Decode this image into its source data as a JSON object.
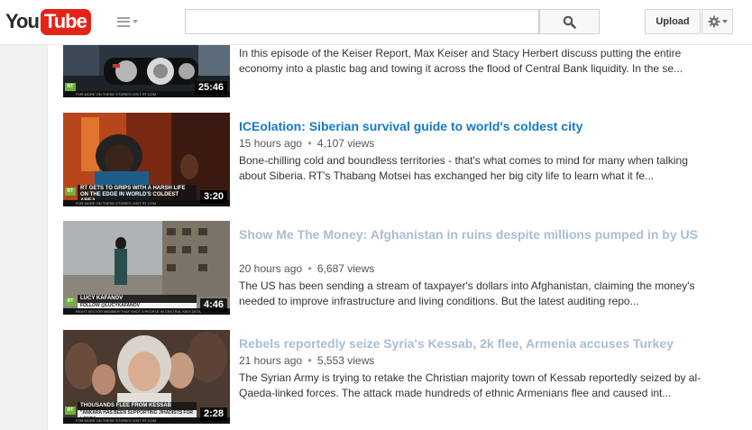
{
  "header": {
    "logo_you": "You",
    "logo_tube": "Tube",
    "search_placeholder": "",
    "upload_label": "Upload"
  },
  "videos": [
    {
      "title": "",
      "meta_time": "",
      "meta_views": "",
      "description": "In this episode of the Keiser Report, Max Keiser and Stacy Herbert discuss putting the entire economy into a plastic bag and towing it across the flood of Central Bank liquidity. In the se...",
      "duration": "25:46",
      "ticker": "FOR MORE ON THESE STORIES VISIT RT.COM"
    },
    {
      "title": "ICEolation: Siberian survival guide to world's coldest city",
      "meta_time": "15 hours ago",
      "meta_views": "4,107 views",
      "description": "Bone-chilling cold and boundless territories - that's what comes to mind for many when talking about Siberia. RT's Thabang Motsei has exchanged her big city life to learn what it fe...",
      "duration": "3:20",
      "lower_third_main": "RT GETS TO GRIPS WITH A HARSH LIFE ON THE EDGE IN WORLD'S COLDEST AREA",
      "ticker": "FOR MORE ON THESE STORIES VISIT RT.COM"
    },
    {
      "title": "Show Me The Money: Afghanistan in ruins despite millions pumped in by US",
      "meta_time": "20 hours ago",
      "meta_views": "6,687 views",
      "description": "The US has been sending a stream of taxpayer's dollars into Afghanistan, claiming the money's needed to improve infrastructure and living conditions. But the latest auditing repo...",
      "duration": "4:46",
      "lower_third_main": "LUCY KAFANOV",
      "lower_third_sub": "FOLLOW @LUCYKAFANOV",
      "ticker": "RIGHT SECTOR MEMBER THAT SHOT 3 PEOPLE IN CENTRAL KIEV DETA"
    },
    {
      "title": "Rebels reportedly seize Syria's Kessab, 2k flee, Armenia accuses Turkey",
      "meta_time": "21 hours ago",
      "meta_views": "5,553 views",
      "description": "The Syrian Army is trying to retake the Christian majority town of Kessab reportedly seized by al-Qaeda-linked forces. The attack made hundreds of ethnic Armenians flee and caused int...",
      "duration": "2:28",
      "lower_third_main": "THOUSANDS FLEE FROM KESSAB",
      "lower_third_sub": "\"ANKARA HAS BEEN SUPPORTING JIHADISTS FOR LONG\"",
      "ticker": "FOR MORE ON THESE STORIES VISIT RT.COM"
    }
  ],
  "rt_badge": "RT",
  "colors": {
    "link": "#167ac6",
    "visited_link": "#a8bed6",
    "logo_red": "#e62117",
    "rt_green": "#6fb23a"
  }
}
